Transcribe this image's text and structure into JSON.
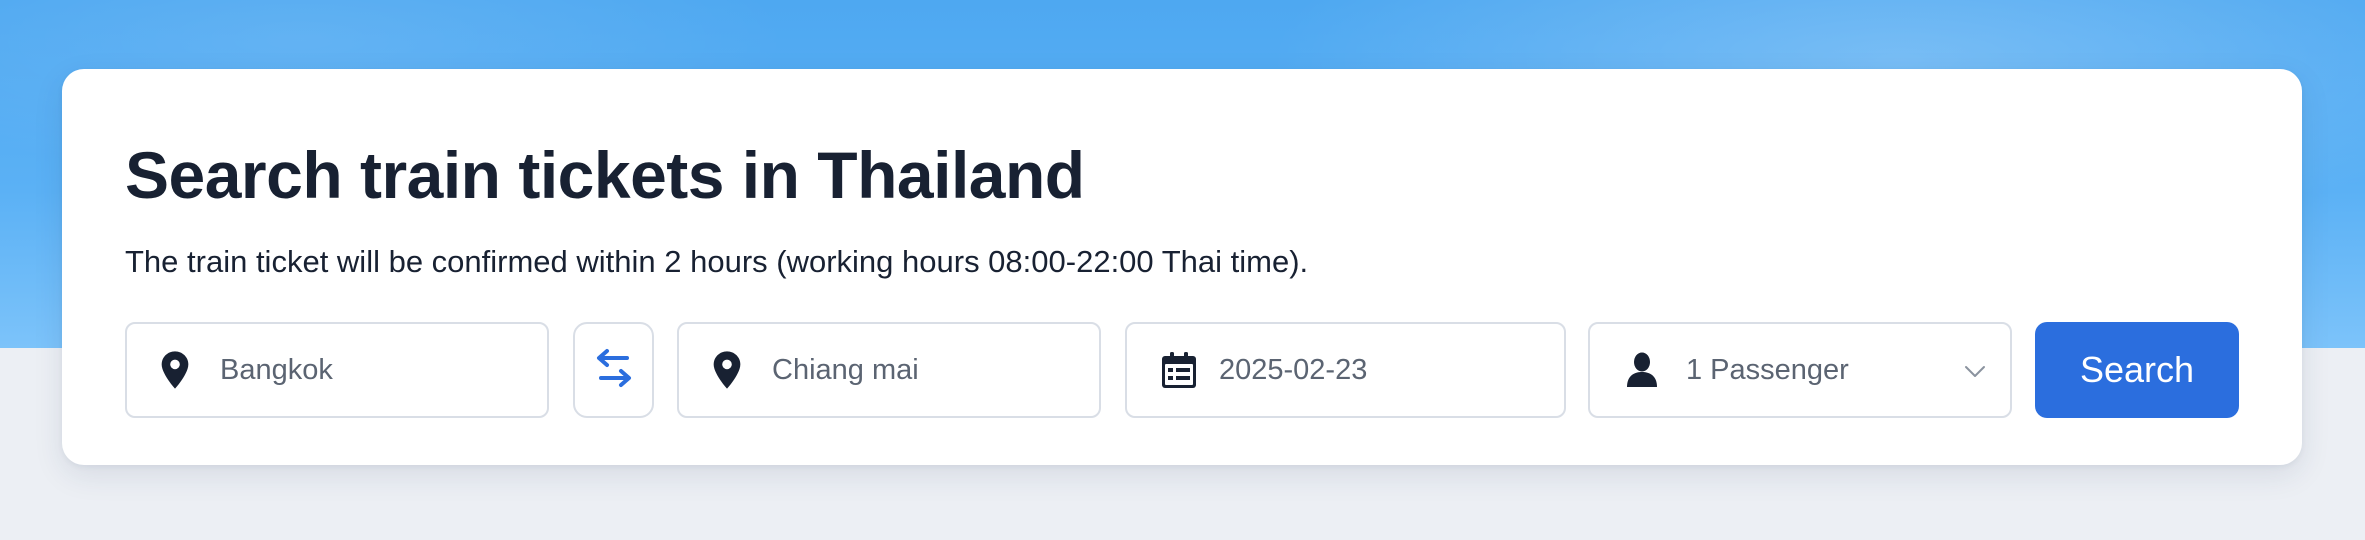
{
  "search_form": {
    "title": "Search train tickets in Thailand",
    "subtitle": "The train ticket will be confirmed within 2 hours (working hours 08:00-22:00 Thai time).",
    "origin": {
      "value": "Bangkok",
      "icon": "location-pin-icon"
    },
    "swap": {
      "icon": "swap-arrows-icon"
    },
    "destination": {
      "value": "Chiang mai",
      "icon": "location-pin-icon"
    },
    "date": {
      "value": "2025-02-23",
      "icon": "calendar-icon"
    },
    "passengers": {
      "value": "1 Passenger",
      "icon": "person-icon",
      "dropdown_icon": "chevron-down-icon"
    },
    "search_label": "Search"
  },
  "colors": {
    "accent": "#2b6ede",
    "heading": "#182132",
    "sky": "#5bb1f5",
    "page_background": "#eceff4"
  }
}
